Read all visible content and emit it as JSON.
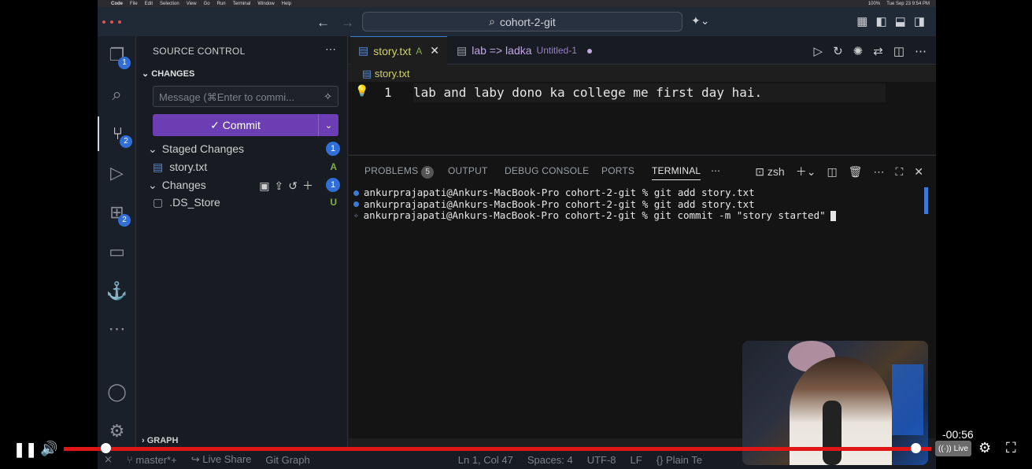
{
  "mac_menu": {
    "items": [
      "Code",
      "File",
      "Edit",
      "Selection",
      "View",
      "Go",
      "Run",
      "Terminal",
      "Window",
      "Help"
    ],
    "clock": "Tue Sep 23  9:54 PM",
    "battery": "100%"
  },
  "titlebar": {
    "search_text": "cohort-2-git"
  },
  "activity": {
    "explorer_badge": "1",
    "scm_badge": "2",
    "extensions_badge": "2"
  },
  "sidebar": {
    "title": "SOURCE CONTROL",
    "section": "CHANGES",
    "message_placeholder": "Message (⌘Enter to commi...",
    "commit_label": "Commit",
    "staged_label": "Staged Changes",
    "staged_count": "1",
    "staged_files": [
      {
        "name": "story.txt",
        "status": "A"
      }
    ],
    "changes_label": "Changes",
    "changes_count": "1",
    "changed_files": [
      {
        "name": ".DS_Store",
        "status": "U"
      }
    ],
    "graph_label": "GRAPH"
  },
  "editor": {
    "tabs": [
      {
        "name": "story.txt",
        "status": "A"
      },
      {
        "name": "lab => ladka",
        "status": "Untitled-1"
      }
    ],
    "breadcrumb": "story.txt",
    "line_number": "1",
    "code_line": "lab and laby dono ka college me first day hai."
  },
  "panel": {
    "tabs": {
      "problems": "PROBLEMS",
      "problems_count": "5",
      "output": "OUTPUT",
      "debug": "DEBUG CONSOLE",
      "ports": "PORTS",
      "terminal": "TERMINAL"
    },
    "shell": "zsh",
    "terminal_lines": [
      "ankurprajapati@Ankurs-MacBook-Pro cohort-2-git % git add story.txt",
      "ankurprajapati@Ankurs-MacBook-Pro cohort-2-git % git add story.txt",
      "ankurprajapati@Ankurs-MacBook-Pro cohort-2-git % git commit -m \"story started\""
    ]
  },
  "statusbar": {
    "branch": "master*+",
    "live_share": "Live Share",
    "git_graph": "Git Graph",
    "position": "Ln 1, Col 47",
    "spaces": "Spaces: 4",
    "encoding": "UTF-8",
    "eol": "LF",
    "language": "Plain Te"
  },
  "player": {
    "remaining": "-00:56",
    "live_label": "Live",
    "progress": 0.05,
    "colors": {
      "progress": "#e01515"
    }
  },
  "colors": {
    "commit_button": "#6b3fb3",
    "badge": "#2f6fd6",
    "accent": "#3a7bd5"
  }
}
